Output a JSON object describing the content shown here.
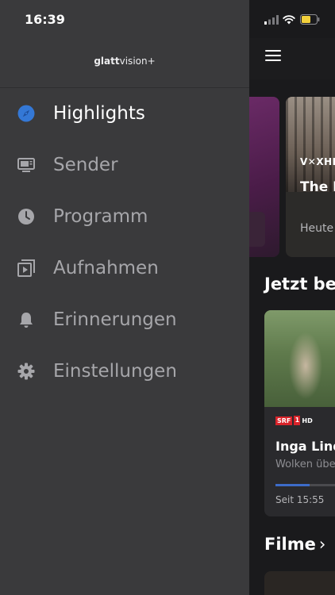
{
  "status_bar": {
    "time": "16:39",
    "battery_color": "#f2d03b"
  },
  "drawer": {
    "logo": {
      "part1": "glatt",
      "part2": "vision+"
    },
    "items": [
      {
        "label": "Highlights",
        "icon": "compass-icon",
        "active": true
      },
      {
        "label": "Sender",
        "icon": "tv-icon",
        "active": false
      },
      {
        "label": "Programm",
        "icon": "clock-icon",
        "active": false
      },
      {
        "label": "Aufnahmen",
        "icon": "recording-icon",
        "active": false
      },
      {
        "label": "Erinnerungen",
        "icon": "bell-icon",
        "active": false
      },
      {
        "label": "Einstellungen",
        "icon": "gear-icon",
        "active": false
      }
    ],
    "accent_color": "#3478d6"
  },
  "background_app": {
    "hero": {
      "channel_logo": "V✕XHD",
      "title": "The B",
      "time": "Heute"
    },
    "now_section": {
      "title": "Jetzt be",
      "card": {
        "channel_logo_1": "SRF",
        "channel_logo_2": "1",
        "channel_logo_3": "HD",
        "title": "Inga Lind",
        "subtitle": "Wolken übe",
        "progress": 0.45,
        "time": "Seit 15:55"
      }
    },
    "films_section": {
      "title": "Filme",
      "chevron": "›"
    }
  }
}
